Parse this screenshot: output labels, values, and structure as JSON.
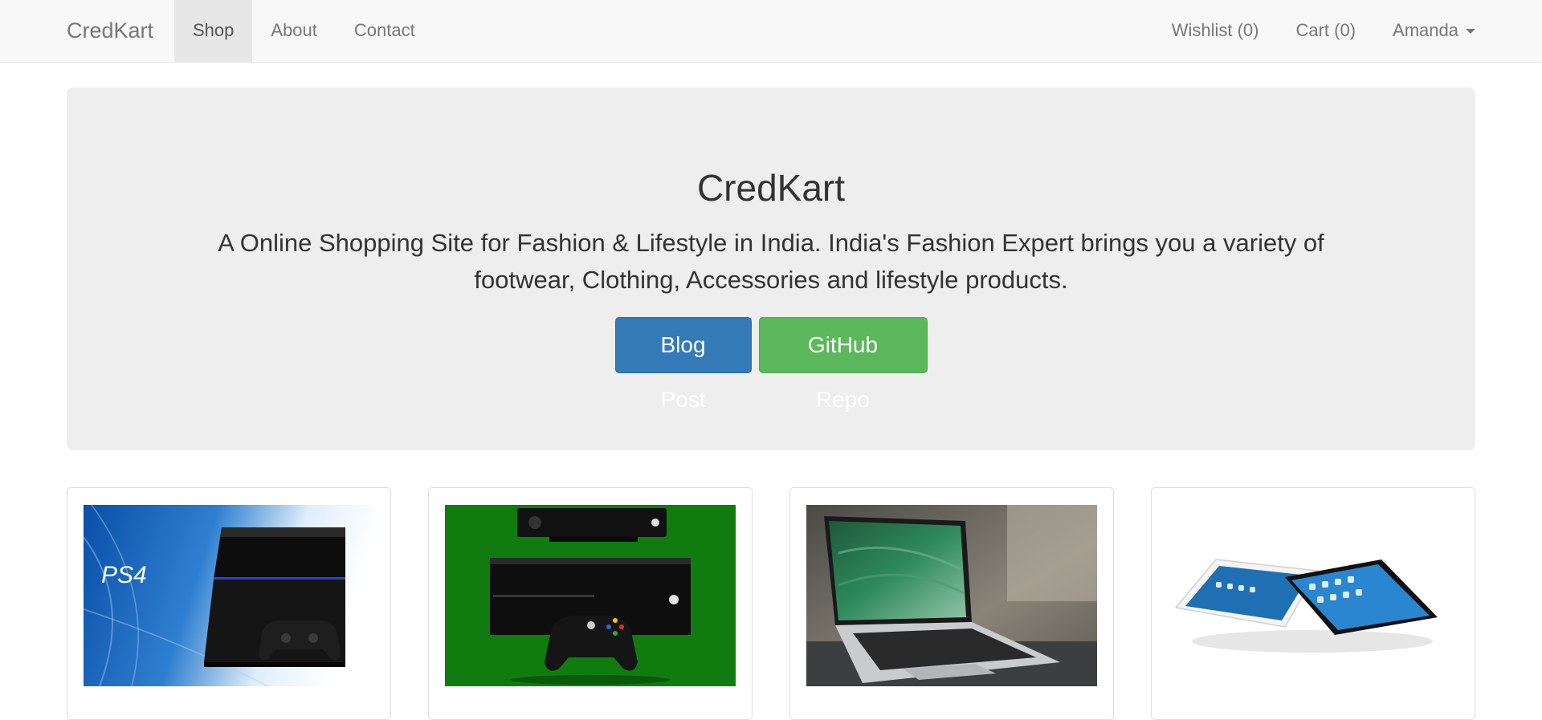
{
  "navbar": {
    "brand": "CredKart",
    "left_items": [
      {
        "label": "Shop",
        "active": true
      },
      {
        "label": "About",
        "active": false
      },
      {
        "label": "Contact",
        "active": false
      }
    ],
    "right_items": {
      "wishlist": "Wishlist (0)",
      "cart": "Cart (0)",
      "user": "Amanda"
    }
  },
  "jumbotron": {
    "title": "CredKart",
    "text": "A Online Shopping Site for Fashion & Lifestyle in India. India's Fashion Expert brings you a variety of footwear, Clothing, Accessories and lifestyle products.",
    "buttons": {
      "blog": "Blog Post",
      "github": "GitHub Repo"
    }
  },
  "products": [
    {
      "image": "ps4-console-image",
      "logo_text": "PS4"
    },
    {
      "image": "xbox-one-console-image"
    },
    {
      "image": "macbook-pro-laptop-image"
    },
    {
      "image": "ipad-tablets-image"
    }
  ],
  "colors": {
    "primary": "#337ab7",
    "success": "#5cb85c",
    "navbar_bg": "#f8f8f8",
    "jumbotron_bg": "#eeeeee",
    "xbox_green": "#107c10"
  }
}
